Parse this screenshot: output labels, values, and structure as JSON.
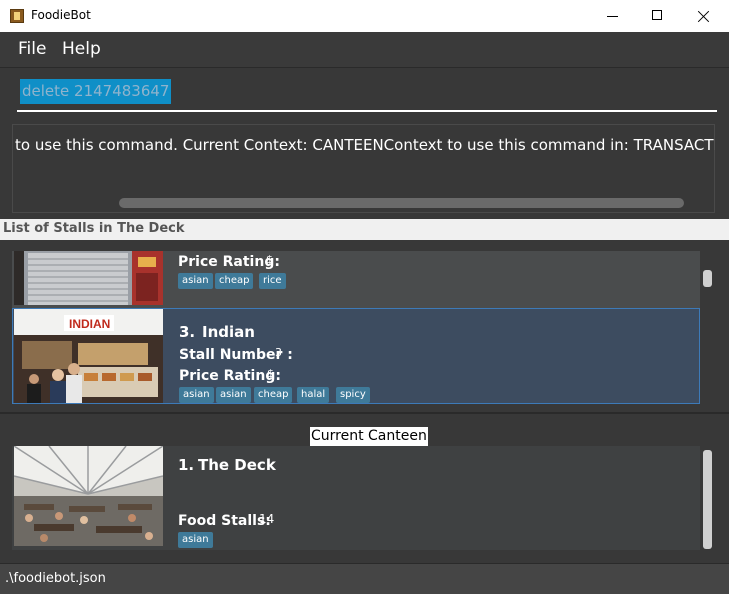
{
  "window": {
    "title": "FoodieBot",
    "icons": {
      "app": "app-icon",
      "minimize": "minimize-icon",
      "maximize": "maximize-icon",
      "close": "close-icon"
    }
  },
  "menu": {
    "items": [
      "File",
      "Help"
    ]
  },
  "command": {
    "value": "delete 2147483647"
  },
  "result": {
    "text": "to use this command. Current Context: CANTEENContext to use this command in: TRANSACTION"
  },
  "stall_list": {
    "title": "List of Stalls in The Deck",
    "price_label": "Price Rating:",
    "number_label": "Stall Number :",
    "items": [
      {
        "price_rating": "$",
        "tags": [
          "asian",
          "cheap",
          "rice"
        ]
      },
      {
        "index": "3.",
        "name": "Indian",
        "stall_number": "3",
        "price_rating": "$",
        "tags": [
          "asian",
          "asian",
          "cheap",
          "halal",
          "spicy"
        ],
        "image_sign": "INDIAN"
      }
    ]
  },
  "current_canteen": {
    "title": "Current Canteen",
    "index": "1.",
    "name": "The Deck",
    "stalls_label": "Food Stalls:",
    "stalls_count": "14",
    "tags": [
      "asian"
    ]
  },
  "status": {
    "text": ".\\foodiebot.json"
  },
  "colors": {
    "accent": "#0f8fc7",
    "tag": "#3f7a99",
    "selected": "#3d4c60",
    "background": "#383838"
  }
}
